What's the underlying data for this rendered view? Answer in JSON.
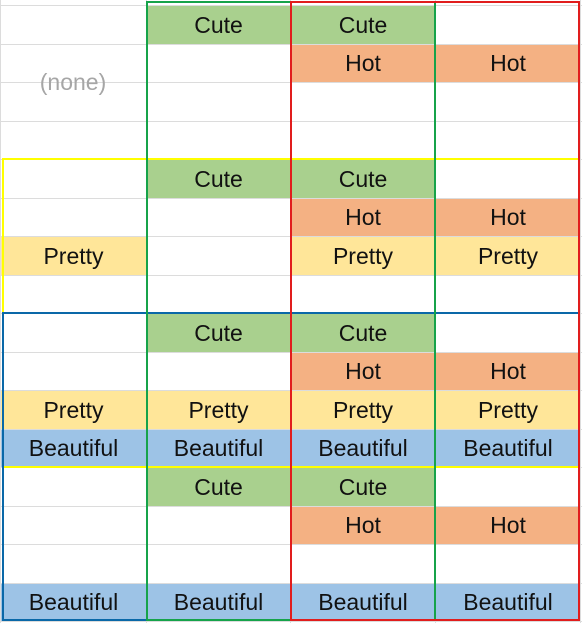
{
  "labels": {
    "none": "(none)",
    "cute": "Cute",
    "hot": "Hot",
    "pretty": "Pretty",
    "beautiful": "Beautiful"
  },
  "colors": {
    "cute": "#a9d08e",
    "hot": "#f4b183",
    "pretty": "#ffe699",
    "beautiful": "#9dc3e6",
    "yellow_border": "#ffff00",
    "blue_border": "#0a68a8",
    "green_border": "#16a34a",
    "red_border": "#e11d1d"
  },
  "cells": [
    {
      "row": 0,
      "col": 1,
      "type": "cute"
    },
    {
      "row": 0,
      "col": 2,
      "type": "cute"
    },
    {
      "row": 1,
      "col": 2,
      "type": "hot"
    },
    {
      "row": 1,
      "col": 3,
      "type": "hot"
    },
    {
      "row": 4,
      "col": 1,
      "type": "cute"
    },
    {
      "row": 4,
      "col": 2,
      "type": "cute"
    },
    {
      "row": 5,
      "col": 2,
      "type": "hot"
    },
    {
      "row": 5,
      "col": 3,
      "type": "hot"
    },
    {
      "row": 6,
      "col": 0,
      "type": "pretty"
    },
    {
      "row": 6,
      "col": 2,
      "type": "pretty"
    },
    {
      "row": 6,
      "col": 3,
      "type": "pretty"
    },
    {
      "row": 8,
      "col": 1,
      "type": "cute"
    },
    {
      "row": 8,
      "col": 2,
      "type": "cute"
    },
    {
      "row": 9,
      "col": 2,
      "type": "hot"
    },
    {
      "row": 9,
      "col": 3,
      "type": "hot"
    },
    {
      "row": 10,
      "col": 0,
      "type": "pretty"
    },
    {
      "row": 10,
      "col": 1,
      "type": "pretty"
    },
    {
      "row": 10,
      "col": 2,
      "type": "pretty"
    },
    {
      "row": 10,
      "col": 3,
      "type": "pretty"
    },
    {
      "row": 11,
      "col": 0,
      "type": "beautiful"
    },
    {
      "row": 11,
      "col": 1,
      "type": "beautiful"
    },
    {
      "row": 11,
      "col": 2,
      "type": "beautiful"
    },
    {
      "row": 11,
      "col": 3,
      "type": "beautiful"
    },
    {
      "row": 12,
      "col": 1,
      "type": "cute"
    },
    {
      "row": 12,
      "col": 2,
      "type": "cute"
    },
    {
      "row": 13,
      "col": 2,
      "type": "hot"
    },
    {
      "row": 13,
      "col": 3,
      "type": "hot"
    },
    {
      "row": 15,
      "col": 0,
      "type": "beautiful"
    },
    {
      "row": 15,
      "col": 1,
      "type": "beautiful"
    },
    {
      "row": 15,
      "col": 2,
      "type": "beautiful"
    },
    {
      "row": 15,
      "col": 3,
      "type": "beautiful"
    }
  ]
}
